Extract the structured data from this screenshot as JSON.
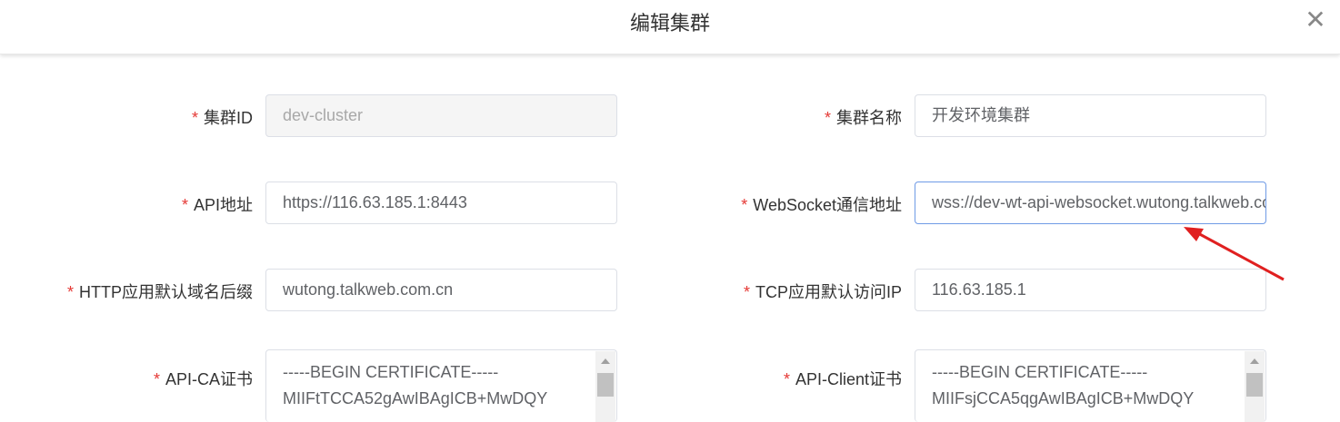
{
  "dialog": {
    "title": "编辑集群",
    "close_icon": "close-icon"
  },
  "required_mark": "*",
  "fields": {
    "cluster_id": {
      "label": "集群ID",
      "value": "dev-cluster"
    },
    "cluster_name": {
      "label": "集群名称",
      "value": "开发环境集群"
    },
    "api_address": {
      "label": "API地址",
      "value": "https://116.63.185.1:8443"
    },
    "websocket_address": {
      "label": "WebSocket通信地址",
      "value": "wss://dev-wt-api-websocket.wutong.talkweb.com.cn"
    },
    "http_domain_suffix": {
      "label": "HTTP应用默认域名后缀",
      "value": "wutong.talkweb.com.cn"
    },
    "tcp_default_ip": {
      "label": "TCP应用默认访问IP",
      "value": "116.63.185.1"
    },
    "api_ca_cert": {
      "label": "API-CA证书",
      "lines": [
        "-----BEGIN CERTIFICATE-----",
        "MIIFtTCCA52gAwIBAgICB+MwDQY"
      ]
    },
    "api_client_cert": {
      "label": "API-Client证书",
      "lines": [
        "-----BEGIN CERTIFICATE-----",
        "MIIFsjCCA5qgAwIBAgICB+MwDQY"
      ]
    }
  },
  "annotation": {
    "color": "#e02020"
  }
}
